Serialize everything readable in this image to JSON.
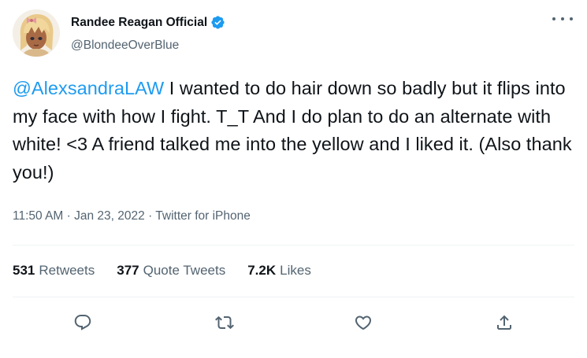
{
  "author": {
    "display_name": "Randee Reagan Official",
    "handle": "@BlondeeOverBlue",
    "verified": true,
    "avatar": "avatar-illustration"
  },
  "tweet": {
    "mention": "@AlexsandraLAW",
    "body": " I wanted to do hair down so badly but it flips into my face with how I fight. T_T And I do plan to do an alternate with white! <3 A friend talked me into the yellow and I liked it. (Also thank you!)",
    "time": "11:50 AM",
    "date": "Jan 23, 2022",
    "source": "Twitter for iPhone",
    "separator": " · "
  },
  "stats": {
    "retweets": {
      "count": "531",
      "label": "Retweets"
    },
    "quote_tweets": {
      "count": "377",
      "label": "Quote Tweets"
    },
    "likes": {
      "count": "7.2K",
      "label": "Likes"
    }
  },
  "actions": {
    "reply": "reply-icon",
    "retweet": "retweet-icon",
    "like": "heart-icon",
    "share": "share-icon"
  },
  "colors": {
    "accent": "#1d9bf0",
    "text": "#0f1419",
    "muted": "#536471",
    "divider": "#eff3f4"
  }
}
